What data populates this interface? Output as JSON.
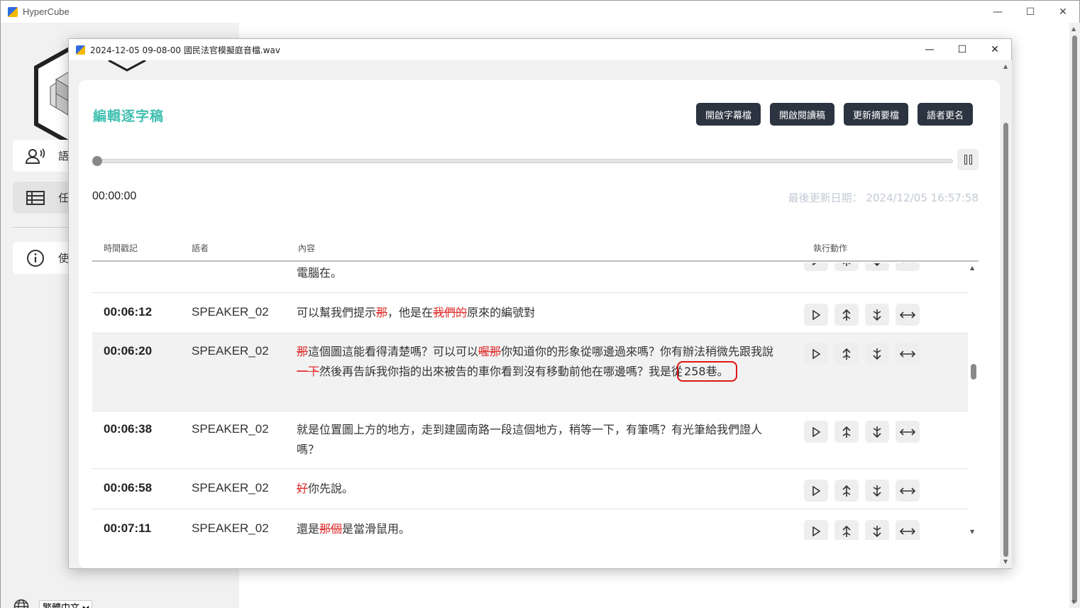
{
  "main_window": {
    "title": "HyperCube",
    "controls": [
      "—",
      "☐",
      "✕"
    ]
  },
  "sidebar": {
    "items": [
      {
        "label": "語",
        "icon": "speaker-voice-icon"
      },
      {
        "label": "任",
        "icon": "list-table-icon"
      },
      {
        "label": "使",
        "icon": "info-icon"
      }
    ],
    "language": "繁體中文",
    "language_options": [
      "繁體中文"
    ]
  },
  "modal": {
    "title": "2024-12-05 09-08-00 國民法官模擬庭音檔.wav",
    "controls": [
      "—",
      "☐",
      "✕"
    ],
    "page_title": "編輯逐字稿",
    "buttons": {
      "subtitle": "開啟字幕檔",
      "read": "開啟閱讀稿",
      "summary": "更新摘要檔",
      "rename": "語者更名"
    },
    "player": {
      "current_time": "00:00:00",
      "progress": 0
    },
    "updated_label": "最後更新日期：",
    "updated_value": "2024/12/05 16:57:58",
    "table": {
      "headers": {
        "timestamp": "時間戳記",
        "speaker": "語者",
        "content": "內容",
        "actions": "執行動作"
      },
      "partial_row_text": "電腦在。",
      "rows": [
        {
          "time": "00:06:12",
          "speaker": "SPEAKER_02",
          "segments": [
            {
              "t": "可以幫我們提示"
            },
            {
              "t": "那",
              "del": true
            },
            {
              "t": "，他是在"
            },
            {
              "t": "我們的",
              "del": true
            },
            {
              "t": "原來的編號對"
            }
          ]
        },
        {
          "time": "00:06:20",
          "speaker": "SPEAKER_02",
          "highlight": true,
          "segments": [
            {
              "t": "那",
              "del": true
            },
            {
              "t": "這個圖這能看得清楚嗎？可以可以"
            },
            {
              "t": "喔那",
              "del": true
            },
            {
              "t": "你知道你的形象從哪邊過來嗎？你有辦法稍微先跟我說"
            },
            {
              "t": "一下",
              "del": true
            },
            {
              "t": "然後再告訴我你指的出來被告的車你看到沒有移動前他在哪邊嗎？我是從"
            },
            {
              "t": "258巷。",
              "circled": true
            }
          ]
        },
        {
          "time": "00:06:38",
          "speaker": "SPEAKER_02",
          "segments": [
            {
              "t": "就是位置圖上方的地方，走到建國南路一段這個地方，稍等一下，有筆嗎？有光筆給我們證人嗎？"
            }
          ]
        },
        {
          "time": "00:06:58",
          "speaker": "SPEAKER_02",
          "segments": [
            {
              "t": "好",
              "del": true
            },
            {
              "t": "你先說。"
            }
          ]
        },
        {
          "time": "00:07:11",
          "speaker": "SPEAKER_02",
          "segments": [
            {
              "t": "還是"
            },
            {
              "t": "那個",
              "del": true
            },
            {
              "t": "是當滑鼠用。"
            }
          ]
        }
      ],
      "action_icons": [
        "play-icon",
        "merge-up-icon",
        "merge-down-icon",
        "split-icon"
      ]
    }
  },
  "colors": {
    "accent": "#3fbfb0",
    "button_bg": "#2b3440",
    "deleted_text": "#e03030",
    "annotation_circle": "#e01515"
  }
}
